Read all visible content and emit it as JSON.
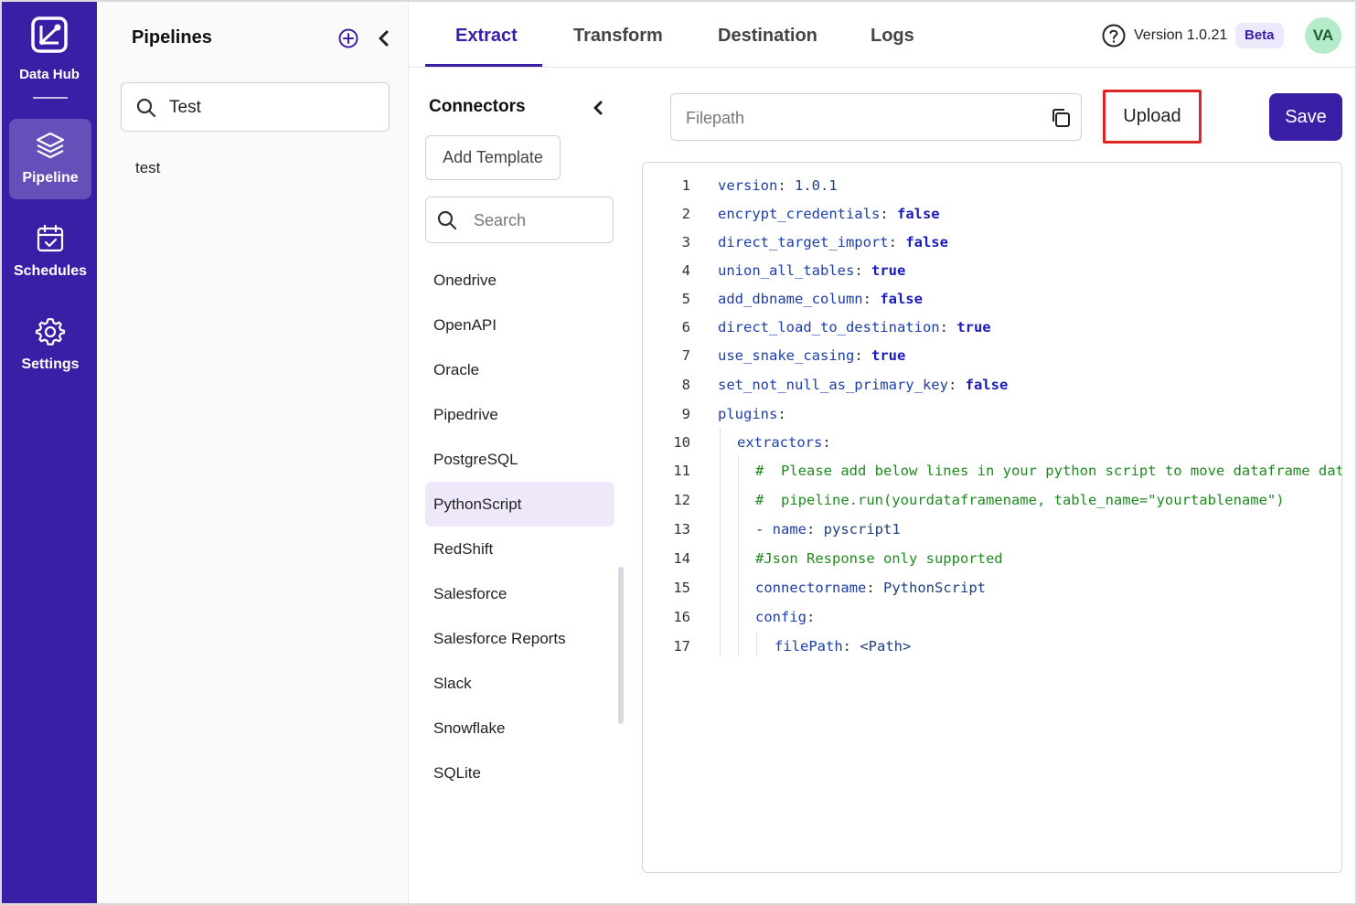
{
  "app": {
    "name": "Data Hub",
    "nav": [
      {
        "label": "Pipeline",
        "icon": "layers-icon",
        "active": true
      },
      {
        "label": "Schedules",
        "icon": "calendar-icon",
        "active": false
      },
      {
        "label": "Settings",
        "icon": "gear-icon",
        "active": false
      }
    ]
  },
  "pipelines": {
    "title": "Pipelines",
    "search_value": "Test",
    "items": [
      "test"
    ]
  },
  "tabs": [
    {
      "label": "Extract",
      "active": true
    },
    {
      "label": "Transform",
      "active": false
    },
    {
      "label": "Destination",
      "active": false
    },
    {
      "label": "Logs",
      "active": false
    }
  ],
  "header": {
    "version": "Version 1.0.21",
    "badge": "Beta",
    "avatar_initials": "VA"
  },
  "connectors": {
    "title": "Connectors",
    "add_template": "Add Template",
    "search_placeholder": "Search",
    "items": [
      "Onedrive",
      "OpenAPI",
      "Oracle",
      "Pipedrive",
      "PostgreSQL",
      "PythonScript",
      "RedShift",
      "Salesforce",
      "Salesforce Reports",
      "Slack",
      "Snowflake",
      "SQLite"
    ],
    "selected": "PythonScript"
  },
  "editor": {
    "filepath_placeholder": "Filepath",
    "upload_label": "Upload",
    "save_label": "Save",
    "lines": [
      {
        "n": "1",
        "indent": 0,
        "key": "version",
        "value": "1.0.1",
        "vtype": "n"
      },
      {
        "n": "2",
        "indent": 0,
        "key": "encrypt_credentials",
        "value": "false",
        "vtype": "b"
      },
      {
        "n": "3",
        "indent": 0,
        "key": "direct_target_import",
        "value": "false",
        "vtype": "b"
      },
      {
        "n": "4",
        "indent": 0,
        "key": "union_all_tables",
        "value": "true",
        "vtype": "b"
      },
      {
        "n": "5",
        "indent": 0,
        "key": "add_dbname_column",
        "value": "false",
        "vtype": "b"
      },
      {
        "n": "6",
        "indent": 0,
        "key": "direct_load_to_destination",
        "value": "true",
        "vtype": "b"
      },
      {
        "n": "7",
        "indent": 0,
        "key": "use_snake_casing",
        "value": "true",
        "vtype": "b"
      },
      {
        "n": "8",
        "indent": 0,
        "key": "set_not_null_as_primary_key",
        "value": "false",
        "vtype": "b"
      },
      {
        "n": "9",
        "indent": 0,
        "key": "plugins",
        "value": "",
        "vtype": "n"
      },
      {
        "n": "10",
        "indent": 1,
        "key": "extractors",
        "value": "",
        "vtype": "n"
      },
      {
        "n": "11",
        "indent": 2,
        "comment": "#  Please add below lines in your python script to move dataframe data"
      },
      {
        "n": "12",
        "indent": 2,
        "comment": "#  pipeline.run(yourdataframename, table_name=\"yourtablename\")"
      },
      {
        "n": "13",
        "indent": 2,
        "dash": "- ",
        "key": "name",
        "value": "pyscript1",
        "vtype": "n"
      },
      {
        "n": "14",
        "indent": 2,
        "comment": "#Json Response only supported"
      },
      {
        "n": "15",
        "indent": 2,
        "key": "connectorname",
        "value": "PythonScript",
        "vtype": "n"
      },
      {
        "n": "16",
        "indent": 2,
        "key": "config",
        "value": "",
        "vtype": "n"
      },
      {
        "n": "17",
        "indent": 3,
        "key": "filePath",
        "value": "<Path>",
        "vtype": "n"
      }
    ]
  }
}
